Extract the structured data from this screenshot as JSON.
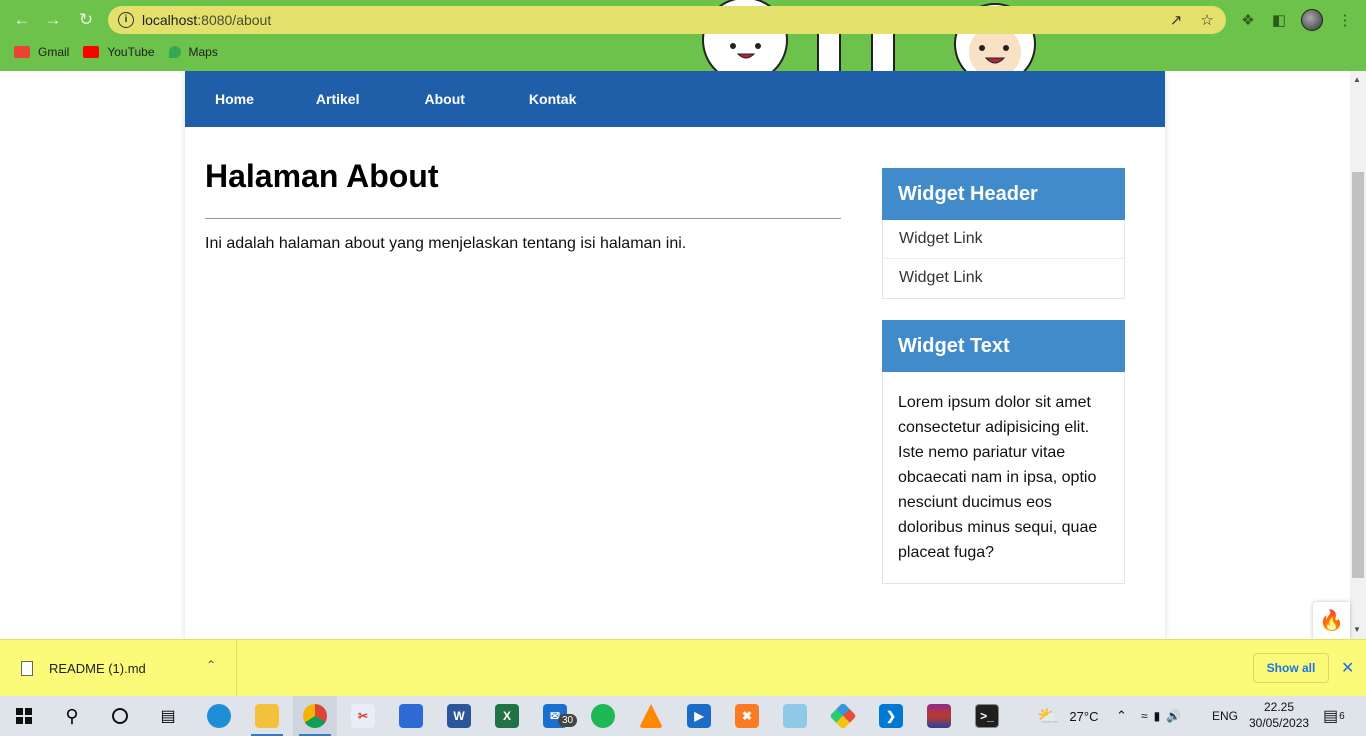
{
  "browser": {
    "url_host": "localhost",
    "url_path": ":8080/about",
    "bookmarks": [
      {
        "label": "Gmail",
        "icon": "gmail-icon",
        "color": "#ea4335"
      },
      {
        "label": "YouTube",
        "icon": "youtube-icon",
        "color": "#ff0000"
      },
      {
        "label": "Maps",
        "icon": "maps-icon",
        "color": "#34a853"
      }
    ],
    "theme_color": "#6cc24a"
  },
  "nav": {
    "items": [
      {
        "label": "Home"
      },
      {
        "label": "Artikel"
      },
      {
        "label": "About"
      },
      {
        "label": "Kontak"
      }
    ],
    "color": "#1f5ea8"
  },
  "main": {
    "title": "Halaman About",
    "body": "Ini adalah halaman about yang menjelaskan tentang isi halaman ini."
  },
  "sidebar": {
    "widget_header": {
      "title": "Widget Header",
      "links": [
        "Widget Link",
        "Widget Link"
      ]
    },
    "widget_text": {
      "title": "Widget Text",
      "body": "Lorem ipsum dolor sit amet consectetur adipisicing elit. Iste nemo pariatur vitae obcaecati nam in ipsa, optio nesciunt ducimus eos doloribus minus sequi, quae placeat fuga?"
    },
    "accent": "#428bca"
  },
  "downloads": {
    "file_name": "README (1).md",
    "show_all_label": "Show all"
  },
  "taskbar": {
    "weather": "27°C",
    "language": "ENG",
    "time": "22.25",
    "date": "30/05/2023",
    "mail_badge": "30",
    "notification_count": "6"
  }
}
